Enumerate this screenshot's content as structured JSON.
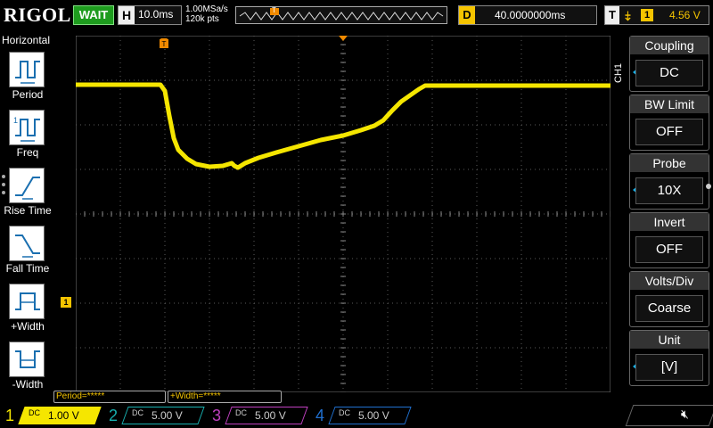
{
  "header": {
    "logo": "RIGOL",
    "run_status": "WAIT",
    "timebase": {
      "label": "H",
      "value": "10.0ms"
    },
    "sample_rate": "1.00MSa/s",
    "memory_depth": "120k pts",
    "trigger_position_marker": "T",
    "delay": {
      "label": "D",
      "value": "40.0000000ms"
    },
    "trigger": {
      "label": "T",
      "source": "1",
      "level": "4.56 V",
      "edge_symbol": "⤈"
    }
  },
  "left_panel": {
    "title": "Horizontal",
    "items": [
      {
        "label": "Period",
        "icon": "period-icon"
      },
      {
        "label": "Freq",
        "icon": "freq-icon"
      },
      {
        "label": "Rise Time",
        "icon": "rise-time-icon"
      },
      {
        "label": "Fall Time",
        "icon": "fall-time-icon"
      },
      {
        "label": "+Width",
        "icon": "positive-width-icon"
      },
      {
        "label": "-Width",
        "icon": "negative-width-icon"
      }
    ]
  },
  "screen": {
    "ch1_ground_marker": "1",
    "trigger_marker": "T"
  },
  "right_menu": {
    "channel_tab": "CH1",
    "items": [
      {
        "title": "Coupling",
        "value": "DC",
        "has_arrow": true
      },
      {
        "title": "BW Limit",
        "value": "OFF",
        "has_arrow": false
      },
      {
        "title": "Probe",
        "value": "10X",
        "has_arrow": true
      },
      {
        "title": "Invert",
        "value": "OFF",
        "has_arrow": false
      },
      {
        "title": "Volts/Div",
        "value": "Coarse",
        "has_arrow": false
      },
      {
        "title": "Unit",
        "value": "[V]",
        "has_arrow": true
      }
    ]
  },
  "measurements": [
    {
      "text": "Period=*****"
    },
    {
      "text": "+Width=*****"
    }
  ],
  "channels": [
    {
      "num": "1",
      "coupling": "DC",
      "scale": "1.00 V",
      "color": "#f5e600",
      "active": true
    },
    {
      "num": "2",
      "coupling": "DC",
      "scale": "5.00 V",
      "color": "#18b0b0",
      "active": false
    },
    {
      "num": "3",
      "coupling": "DC",
      "scale": "5.00 V",
      "color": "#c040c0",
      "active": false
    },
    {
      "num": "4",
      "coupling": "DC",
      "scale": "5.00 V",
      "color": "#2070d0",
      "active": false
    }
  ],
  "colors": {
    "ch1_trace": "#f5e600",
    "grid": "#5a5a5a",
    "accent": "#18b0e8"
  }
}
